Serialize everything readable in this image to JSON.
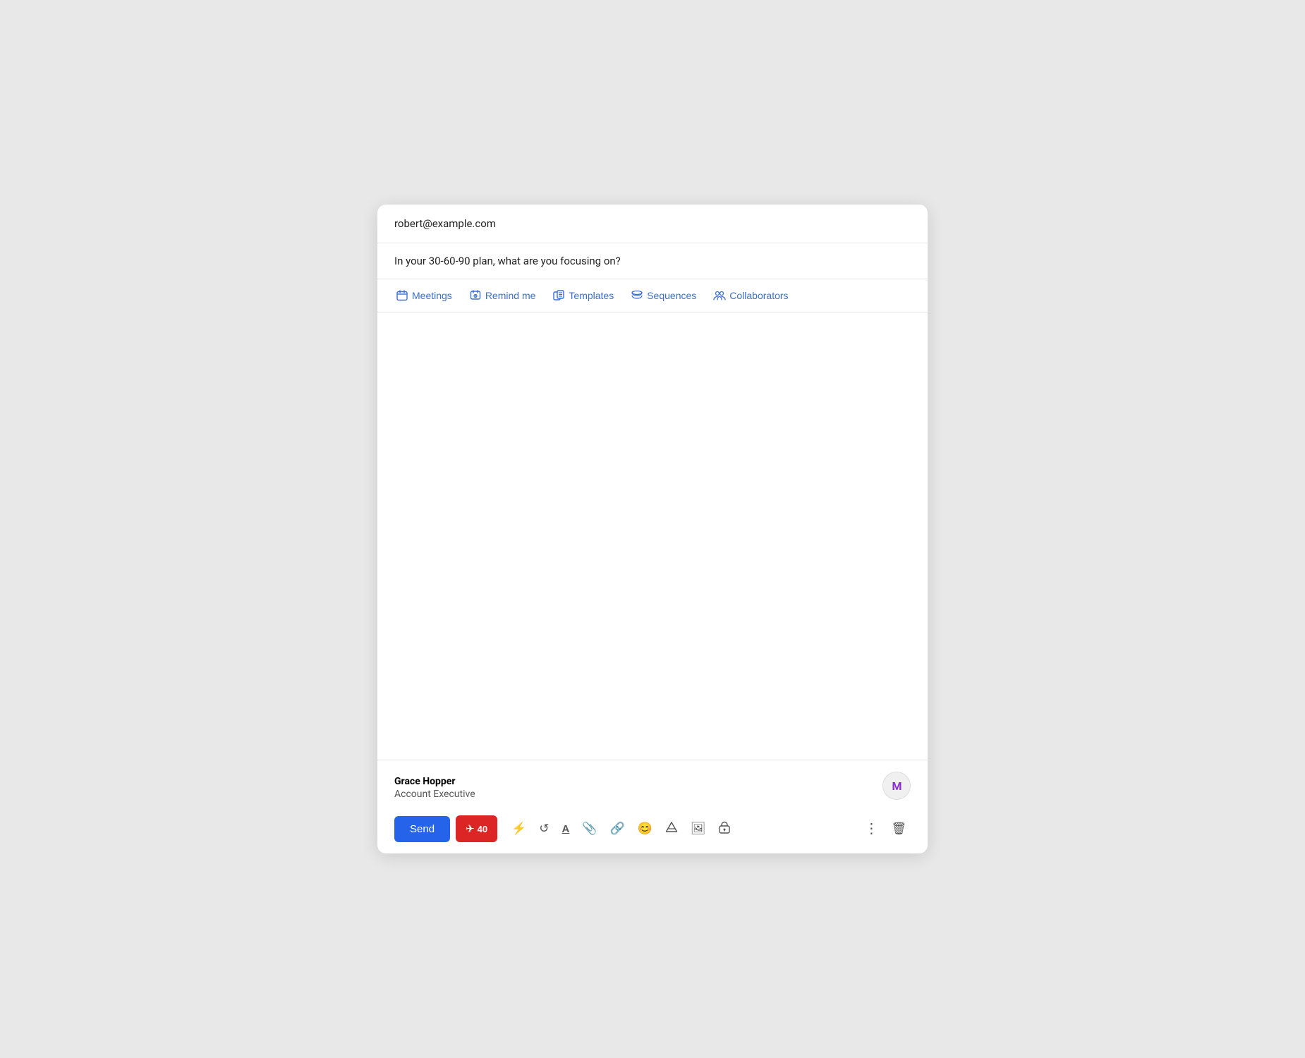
{
  "compose": {
    "to": "robert@example.com",
    "subject": "In your 30-60-90 plan, what are you focusing on?",
    "body": "",
    "toolbar": {
      "meetings_label": "Meetings",
      "remind_me_label": "Remind me",
      "templates_label": "Templates",
      "sequences_label": "Sequences",
      "collaborators_label": "Collaborators"
    },
    "signature": {
      "name": "Grace Hopper",
      "title": "Account Executive"
    },
    "bottom": {
      "send_label": "Send",
      "avatar_label": "M"
    }
  }
}
